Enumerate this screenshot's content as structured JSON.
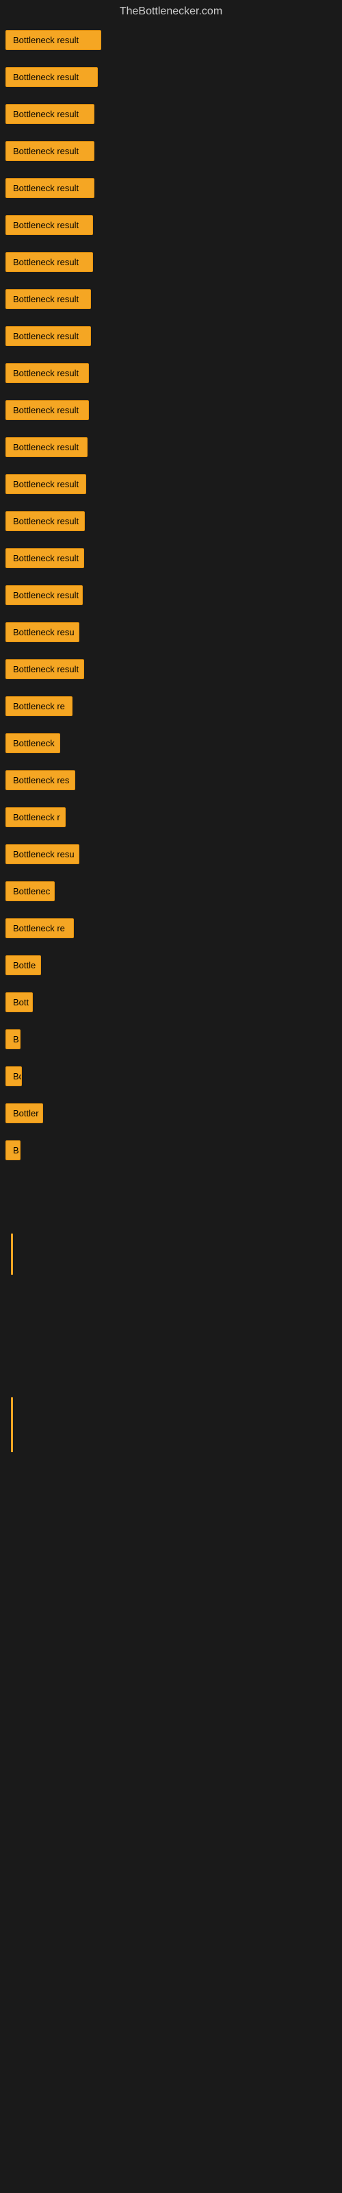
{
  "site": {
    "title": "TheBottlenecker.com"
  },
  "items": [
    {
      "label": "Bottleneck result",
      "width": 140,
      "marginTop": 8
    },
    {
      "label": "Bottleneck result",
      "width": 135,
      "marginTop": 8
    },
    {
      "label": "Bottleneck result",
      "width": 130,
      "marginTop": 8
    },
    {
      "label": "Bottleneck result",
      "width": 130,
      "marginTop": 8
    },
    {
      "label": "Bottleneck result",
      "width": 130,
      "marginTop": 8
    },
    {
      "label": "Bottleneck result",
      "width": 128,
      "marginTop": 8
    },
    {
      "label": "Bottleneck result",
      "width": 128,
      "marginTop": 8
    },
    {
      "label": "Bottleneck result",
      "width": 125,
      "marginTop": 8
    },
    {
      "label": "Bottleneck result",
      "width": 125,
      "marginTop": 8
    },
    {
      "label": "Bottleneck result",
      "width": 122,
      "marginTop": 8
    },
    {
      "label": "Bottleneck result",
      "width": 122,
      "marginTop": 8
    },
    {
      "label": "Bottleneck result",
      "width": 120,
      "marginTop": 8
    },
    {
      "label": "Bottleneck result",
      "width": 118,
      "marginTop": 8
    },
    {
      "label": "Bottleneck result",
      "width": 116,
      "marginTop": 8
    },
    {
      "label": "Bottleneck result",
      "width": 115,
      "marginTop": 8
    },
    {
      "label": "Bottleneck result",
      "width": 113,
      "marginTop": 8
    },
    {
      "label": "Bottleneck resu",
      "width": 108,
      "marginTop": 8
    },
    {
      "label": "Bottleneck result",
      "width": 115,
      "marginTop": 8
    },
    {
      "label": "Bottleneck re",
      "width": 98,
      "marginTop": 8
    },
    {
      "label": "Bottleneck",
      "width": 80,
      "marginTop": 8
    },
    {
      "label": "Bottleneck res",
      "width": 102,
      "marginTop": 8
    },
    {
      "label": "Bottleneck r",
      "width": 88,
      "marginTop": 8
    },
    {
      "label": "Bottleneck resu",
      "width": 108,
      "marginTop": 8
    },
    {
      "label": "Bottlenec",
      "width": 72,
      "marginTop": 8
    },
    {
      "label": "Bottleneck re",
      "width": 100,
      "marginTop": 8
    },
    {
      "label": "Bottle",
      "width": 52,
      "marginTop": 8
    },
    {
      "label": "Bott",
      "width": 40,
      "marginTop": 8
    },
    {
      "label": "B",
      "width": 18,
      "marginTop": 8
    },
    {
      "label": "Bo",
      "width": 24,
      "marginTop": 8
    },
    {
      "label": "Bottler",
      "width": 55,
      "marginTop": 8
    },
    {
      "label": "B",
      "width": 16,
      "marginTop": 8
    }
  ],
  "bars": [
    {
      "height": 60
    },
    {
      "height": 50
    },
    {
      "height": 40
    },
    {
      "height": 80
    }
  ]
}
